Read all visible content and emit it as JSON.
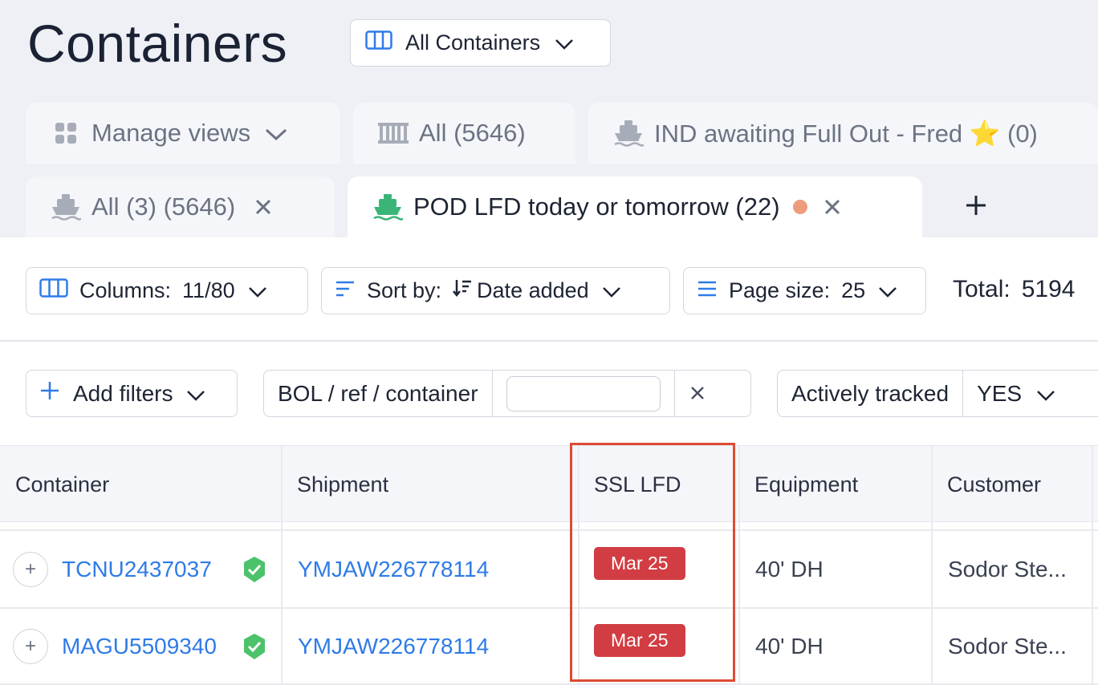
{
  "header": {
    "title": "Containers",
    "view_select": "All Containers"
  },
  "tabs_row1": [
    {
      "label": "Manage views"
    },
    {
      "label": "All (5646)"
    },
    {
      "label": "IND awaiting Full Out - Fred ⭐ (0)"
    }
  ],
  "tabs_row2": [
    {
      "label": "All (3) (5646)",
      "active": false
    },
    {
      "label": "POD LFD today or tomorrow (22)",
      "active": true
    }
  ],
  "toolbar": {
    "columns_label": "Columns:",
    "columns_value": "11/80",
    "sort_label": "Sort by:",
    "sort_value": "Date added",
    "page_size_label": "Page size:",
    "page_size_value": "25",
    "total_label": "Total:",
    "total_value": "5194"
  },
  "filters": {
    "add_filters": "Add filters",
    "search_label": "BOL / ref / container",
    "search_value": "",
    "tracked_label": "Actively tracked",
    "tracked_value": "YES"
  },
  "table": {
    "columns": [
      "Container",
      "Shipment",
      "SSL LFD",
      "Equipment",
      "Customer"
    ],
    "rows": [
      {
        "container": "TCNU2437037",
        "shipment": "YMJAW226778114",
        "ssl_lfd": "Mar 25",
        "equipment": "40' DH",
        "customer": "Sodor Ste..."
      },
      {
        "container": "MAGU5509340",
        "shipment": "YMJAW226778114",
        "ssl_lfd": "Mar 25",
        "equipment": "40' DH",
        "customer": "Sodor Ste..."
      }
    ]
  },
  "colors": {
    "accent": "#2f7be8",
    "lfd_badge": "#d13d42",
    "highlight": "#dd4b35",
    "verified": "#4cc26b",
    "unsaved_dot": "#ee9c7e"
  }
}
